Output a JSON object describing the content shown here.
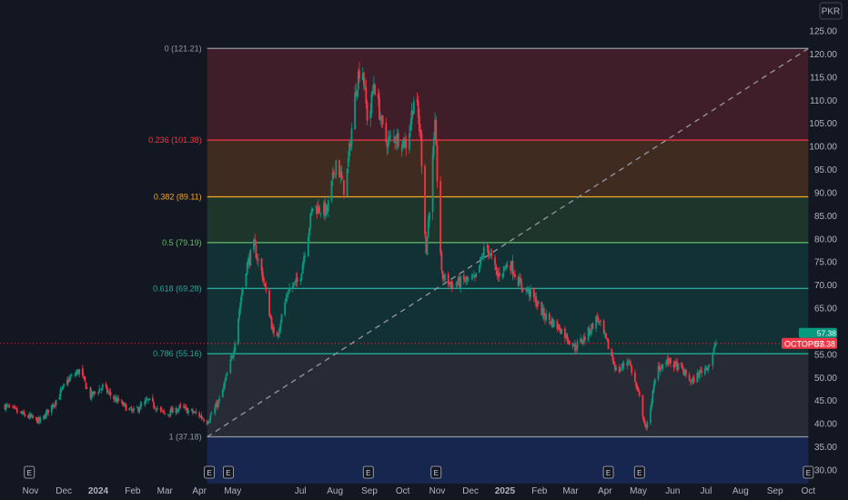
{
  "currency": "PKR",
  "symbol": "OCTOPUS",
  "last_price": "57.38",
  "price_tag_secondary": "57.38",
  "colors": {
    "background": "#131722",
    "up": "#089981",
    "down": "#f23645",
    "axis_text": "#b2b5be"
  },
  "chart_data": {
    "type": "candlestick",
    "x_axis": {
      "type": "date",
      "range": [
        "2023-10-08",
        "2025-10-15"
      ],
      "tick_labels": [
        "Nov",
        "Dec",
        "2024",
        "Feb",
        "Mar",
        "Apr",
        "May",
        "Jul",
        "Aug",
        "Sep",
        "Oct",
        "Nov",
        "Dec",
        "2025",
        "Feb",
        "Mar",
        "Apr",
        "May",
        "Jun",
        "Jul",
        "Aug",
        "Sep",
        "Oct"
      ],
      "tick_dates": [
        "2023-11-01",
        "2023-12-01",
        "2024-01-01",
        "2024-02-01",
        "2024-03-01",
        "2024-04-01",
        "2024-05-01",
        "2024-07-01",
        "2024-08-01",
        "2024-09-01",
        "2024-10-01",
        "2024-11-01",
        "2024-12-01",
        "2025-01-01",
        "2025-02-01",
        "2025-03-01",
        "2025-04-01",
        "2025-05-01",
        "2025-06-01",
        "2025-07-01",
        "2025-08-01",
        "2025-09-01",
        "2025-10-01"
      ]
    },
    "y_axis": {
      "range": [
        28,
        127
      ],
      "ticks": [
        30,
        35,
        40,
        45,
        50,
        55,
        60,
        65,
        70,
        75,
        80,
        85,
        90,
        95,
        100,
        105,
        110,
        115,
        120,
        125
      ],
      "tick_labels": [
        "30.00",
        "35.00",
        "40.00",
        "45.00",
        "50.00",
        "55.00",
        "60.00",
        "65.00",
        "70.00",
        "75.00",
        "80.00",
        "85.00",
        "90.00",
        "95.00",
        "100.00",
        "105.00",
        "110.00",
        "115.00",
        "120.00",
        "125.00"
      ]
    },
    "grid": false,
    "price_path": [
      [
        "2023-10-08",
        44.0
      ],
      [
        "2023-10-25",
        42.0
      ],
      [
        "2023-11-10",
        40.5
      ],
      [
        "2023-11-25",
        45.5
      ],
      [
        "2023-12-05",
        49.5
      ],
      [
        "2023-12-15",
        51.5
      ],
      [
        "2023-12-25",
        46.0
      ],
      [
        "2024-01-05",
        48.0
      ],
      [
        "2024-01-15",
        45.5
      ],
      [
        "2024-02-01",
        42.5
      ],
      [
        "2024-02-15",
        45.0
      ],
      [
        "2024-03-01",
        42.0
      ],
      [
        "2024-03-15",
        43.5
      ],
      [
        "2024-03-31",
        42.0
      ],
      [
        "2024-04-08",
        40.5
      ],
      [
        "2024-04-20",
        45.5
      ],
      [
        "2024-05-01",
        55.0
      ],
      [
        "2024-05-12",
        73.0
      ],
      [
        "2024-05-20",
        78.5
      ],
      [
        "2024-05-28",
        72.0
      ],
      [
        "2024-06-08",
        57.5
      ],
      [
        "2024-06-20",
        69.0
      ],
      [
        "2024-06-30",
        71.0
      ],
      [
        "2024-07-12",
        87.0
      ],
      [
        "2024-07-25",
        86.0
      ],
      [
        "2024-08-02",
        97.0
      ],
      [
        "2024-08-10",
        90.0
      ],
      [
        "2024-08-20",
        113.0
      ],
      [
        "2024-08-25",
        119.0
      ],
      [
        "2024-08-31",
        104.0
      ],
      [
        "2024-09-05",
        114.0
      ],
      [
        "2024-09-15",
        101.0
      ],
      [
        "2024-09-25",
        102.0
      ],
      [
        "2024-10-05",
        100.5
      ],
      [
        "2024-10-12",
        112.0
      ],
      [
        "2024-10-17",
        102.0
      ],
      [
        "2024-10-22",
        77.0
      ],
      [
        "2024-10-30",
        104.0
      ],
      [
        "2024-11-05",
        72.0
      ],
      [
        "2024-11-15",
        70.0
      ],
      [
        "2024-11-25",
        71.0
      ],
      [
        "2024-12-05",
        71.0
      ],
      [
        "2024-12-15",
        79.0
      ],
      [
        "2024-12-25",
        72.0
      ],
      [
        "2025-01-05",
        75.0
      ],
      [
        "2025-01-15",
        70.0
      ],
      [
        "2025-01-25",
        68.0
      ],
      [
        "2025-02-05",
        63.5
      ],
      [
        "2025-02-20",
        60.5
      ],
      [
        "2025-03-05",
        56.5
      ],
      [
        "2025-03-15",
        59.0
      ],
      [
        "2025-03-25",
        63.0
      ],
      [
        "2025-04-05",
        56.0
      ],
      [
        "2025-04-12",
        51.0
      ],
      [
        "2025-04-22",
        54.0
      ],
      [
        "2025-05-02",
        45.5
      ],
      [
        "2025-05-08",
        38.5
      ],
      [
        "2025-05-18",
        52.0
      ],
      [
        "2025-05-28",
        53.5
      ],
      [
        "2025-06-08",
        52.0
      ],
      [
        "2025-06-18",
        49.0
      ],
      [
        "2025-06-25",
        51.0
      ],
      [
        "2025-07-04",
        53.0
      ],
      [
        "2025-07-10",
        57.5
      ]
    ],
    "fibonacci_retracement": {
      "start": {
        "date": "2024-04-08",
        "price": 37.18
      },
      "end": {
        "date": "2025-10-01",
        "price": 121.21
      },
      "levels": [
        {
          "label": "0 (121.21)",
          "ratio": 0,
          "price": 121.21,
          "line_color": "#9598a1",
          "fill_color": "#f23645"
        },
        {
          "label": "0.236 (101.38)",
          "ratio": 0.236,
          "price": 101.38,
          "line_color": "#f23645",
          "fill_color": "#f57f17"
        },
        {
          "label": "0.382 (89.11)",
          "ratio": 0.382,
          "price": 89.11,
          "line_color": "#f5a623",
          "fill_color": "#4caf50"
        },
        {
          "label": "0.5 (79.19)",
          "ratio": 0.5,
          "price": 79.19,
          "line_color": "#66bb6a",
          "fill_color": "#089981"
        },
        {
          "label": "0.618 (69.28)",
          "ratio": 0.618,
          "price": 69.28,
          "line_color": "#26a69a",
          "fill_color": "#089981"
        },
        {
          "label": "0.786 (55.16)",
          "ratio": 0.786,
          "price": 55.16,
          "line_color": "#22ab94",
          "fill_color": "#787b86"
        },
        {
          "label": "1 (37.18)",
          "ratio": 1,
          "price": 37.18,
          "line_color": "#9598a1",
          "fill_color": "#2962ff"
        }
      ]
    },
    "events": [
      {
        "label": "E",
        "date": "2023-10-31"
      },
      {
        "label": "E",
        "date": "2024-04-10"
      },
      {
        "label": "E",
        "date": "2024-04-27"
      },
      {
        "label": "E",
        "date": "2024-08-31"
      },
      {
        "label": "E",
        "date": "2024-10-31"
      },
      {
        "label": "E",
        "date": "2025-04-04"
      },
      {
        "label": "E",
        "date": "2025-05-02"
      },
      {
        "label": "E",
        "date": "2025-10-01"
      }
    ]
  }
}
